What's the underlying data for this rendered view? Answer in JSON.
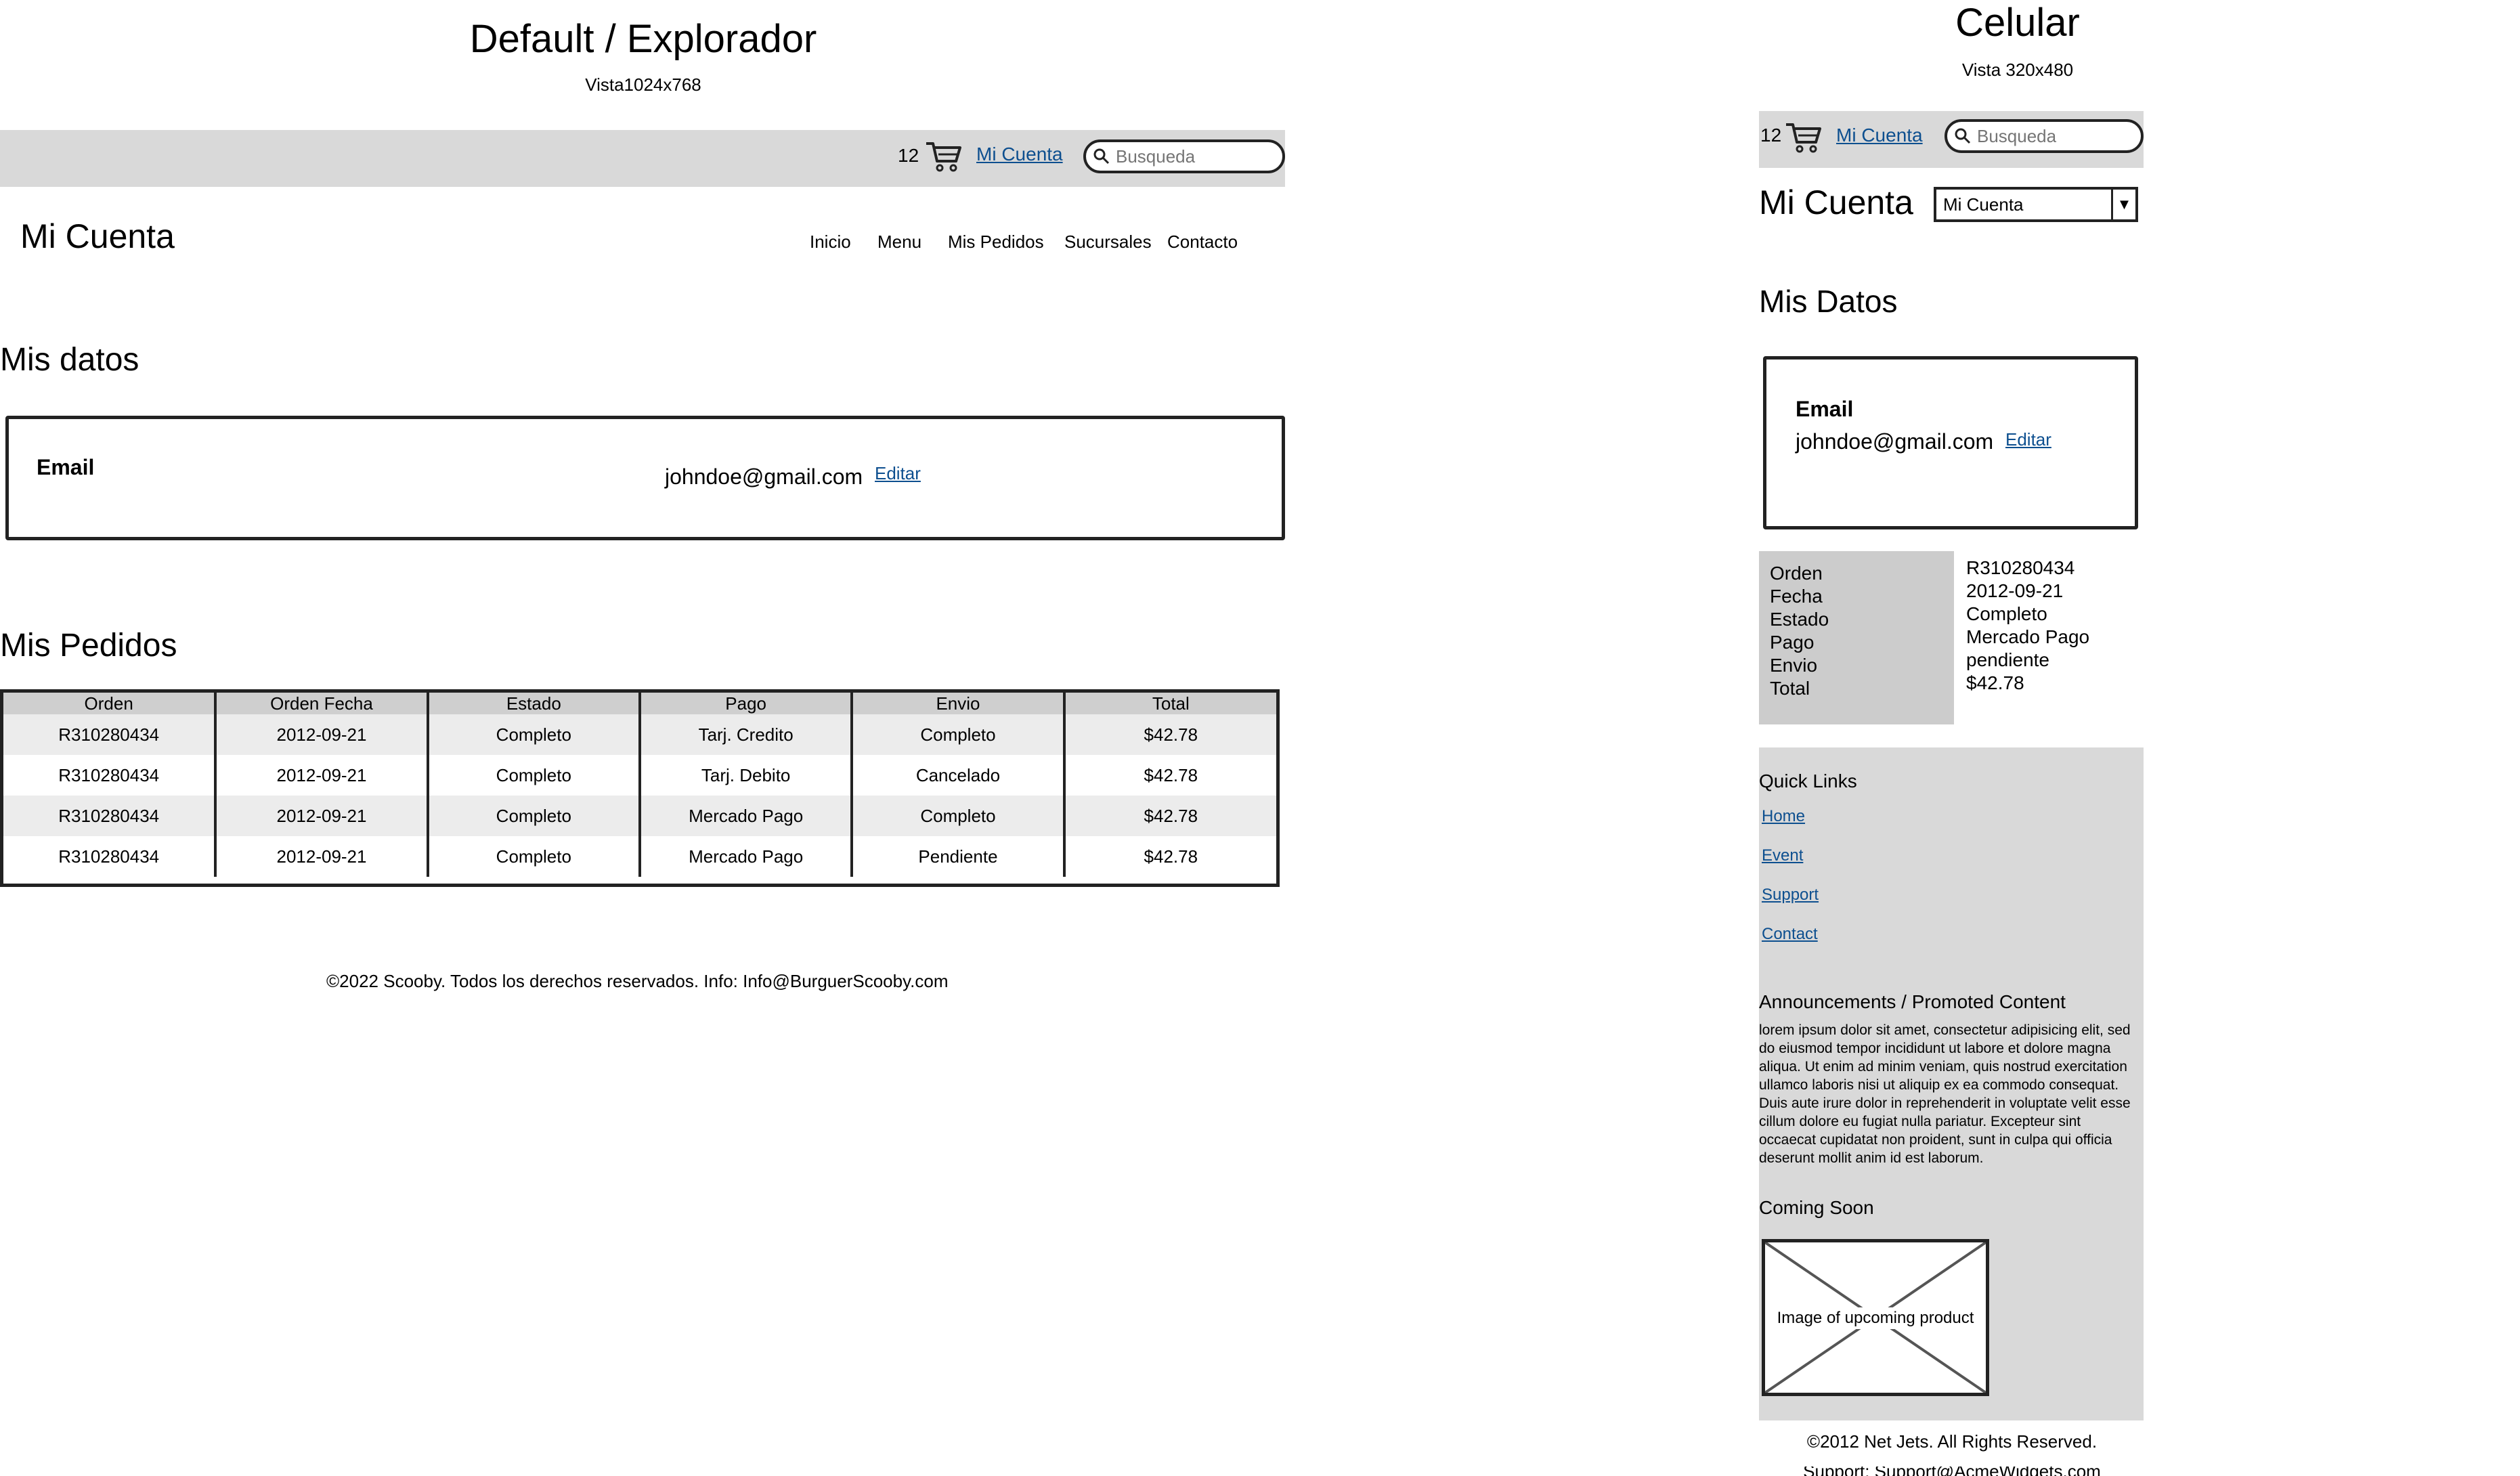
{
  "desktop": {
    "title": "Default / Explorador",
    "subtitle": "Vista1024x768",
    "cart_count": "12",
    "account_link": "Mi Cuenta",
    "search_placeholder": "Busqueda",
    "page_title": "Mi Cuenta",
    "nav": [
      "Inicio",
      "Menu",
      "Mis Pedidos",
      "Sucursales",
      "Contacto"
    ],
    "section_datos": "Mis datos",
    "email_label": "Email",
    "email_value": "johndoe@gmail.com",
    "edit_link": "Editar",
    "section_pedidos": "Mis Pedidos",
    "table_headers": [
      "Orden",
      "Orden Fecha",
      "Estado",
      "Pago",
      "Envio",
      "Total"
    ],
    "table_rows": [
      [
        "R310280434",
        "2012-09-21",
        "Completo",
        "Tarj. Credito",
        "Completo",
        "$42.78"
      ],
      [
        "R310280434",
        "2012-09-21",
        "Completo",
        "Tarj. Debito",
        "Cancelado",
        "$42.78"
      ],
      [
        "R310280434",
        "2012-09-21",
        "Completo",
        "Mercado Pago",
        "Completo",
        "$42.78"
      ],
      [
        "R310280434",
        "2012-09-21",
        "Completo",
        "Mercado Pago",
        "Pendiente",
        "$42.78"
      ]
    ],
    "footer": "©2022 Scooby.  Todos los derechos reservados.  Info: Info@BurguerScooby.com"
  },
  "mobile": {
    "title": "Celular",
    "subtitle": "Vista 320x480",
    "cart_count": "12",
    "account_link": "Mi Cuenta",
    "search_placeholder": "Busqueda",
    "page_title": "Mi Cuenta",
    "select_value": "Mi Cuenta",
    "section_datos": "Mis Datos",
    "email_label": "Email",
    "email_value": "johndoe@gmail.com",
    "edit_link": "Editar",
    "order_labels": [
      "Orden",
      "Fecha",
      "Estado",
      "Pago",
      "Envio",
      "Total"
    ],
    "order_values": [
      "R310280434",
      "2012-09-21",
      "Completo",
      "Mercado Pago",
      "pendiente",
      "$42.78"
    ],
    "quick_links_title": "Quick Links",
    "quick_links": [
      "Home",
      "Event",
      "Support",
      "Contact"
    ],
    "announcements_title": "Announcements / Promoted Content",
    "announcements_body": "lorem ipsum dolor sit amet, consectetur adipisicing elit, sed do eiusmod tempor incididunt ut labore et dolore magna aliqua. Ut enim ad minim veniam, quis nostrud exercitation ullamco laboris nisi ut aliquip ex ea commodo consequat. Duis aute irure dolor in reprehenderit in voluptate velit esse cillum dolore eu fugiat nulla pariatur. Excepteur sint occaecat cupidatat non proident, sunt in culpa qui officia deserunt mollit anim id est laborum.",
    "coming_soon_title": "Coming Soon",
    "image_label": "Image of upcoming product",
    "footer_line1": "©2012 Net Jets.  All Rights Reserved.",
    "footer_line2": "Support: Support@AcmeWidgets.com"
  }
}
